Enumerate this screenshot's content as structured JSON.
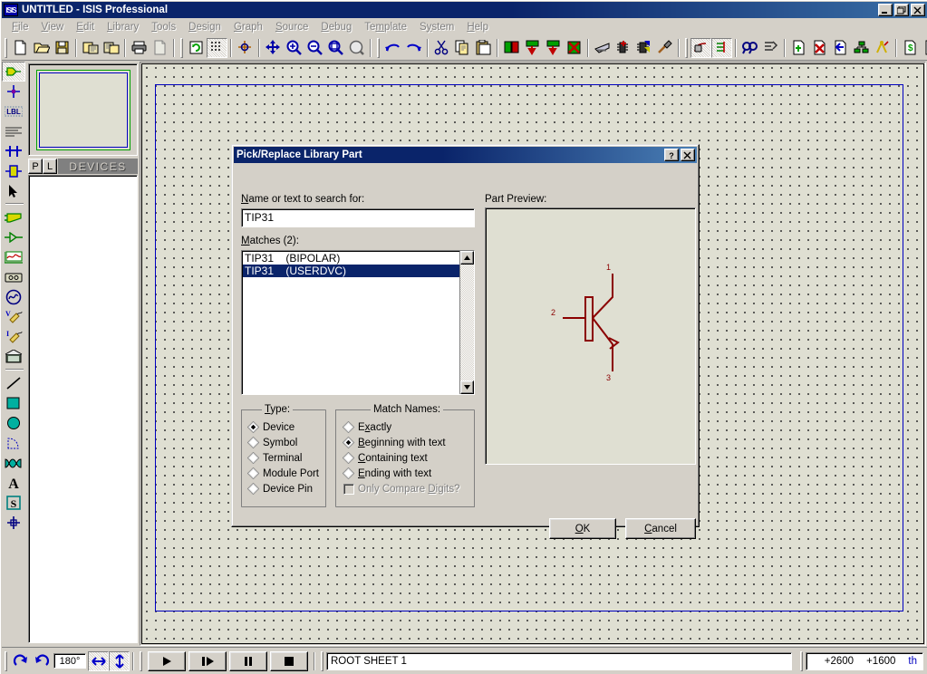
{
  "window": {
    "title": "UNTITLED - ISIS Professional",
    "icon": "isis-logo-icon",
    "minimize": "minimize-button",
    "restore": "restore-button",
    "close": "close-button"
  },
  "menubar": {
    "items": [
      {
        "label": "File",
        "accel": "F"
      },
      {
        "label": "View",
        "accel": "V"
      },
      {
        "label": "Edit",
        "accel": "E"
      },
      {
        "label": "Library",
        "accel": "L"
      },
      {
        "label": "Tools",
        "accel": "T"
      },
      {
        "label": "Design",
        "accel": "D"
      },
      {
        "label": "Graph",
        "accel": "G"
      },
      {
        "label": "Source",
        "accel": "S"
      },
      {
        "label": "Debug",
        "accel": "D"
      },
      {
        "label": "Template",
        "accel": "m"
      },
      {
        "label": "System",
        "accel": "y"
      },
      {
        "label": "Help",
        "accel": "H"
      }
    ]
  },
  "toolbar": {
    "groups": [
      [
        "new-file-icon",
        "open-file-icon",
        "save-file-icon"
      ],
      [
        "import-section-icon",
        "export-section-icon"
      ],
      [
        "print-icon",
        "print-area-icon"
      ],
      [
        "refresh-icon",
        "toggle-grid-icon"
      ],
      [
        "origin-icon"
      ],
      [
        "pan-icon",
        "zoom-in-icon",
        "zoom-out-icon",
        "zoom-area-icon",
        "zoom-all-icon"
      ],
      [
        "undo-icon",
        "redo-icon"
      ],
      [
        "cut-icon",
        "copy-icon",
        "paste-icon"
      ],
      [
        "block-copy-icon",
        "block-move-icon",
        "block-rotate-icon",
        "block-delete-icon"
      ],
      [
        "pick-device-icon",
        "make-device-icon",
        "packaging-tool-icon",
        "decompose-icon"
      ],
      [
        "wire-autorouter-icon",
        "search-tag-icon"
      ],
      [
        "property-assignment-icon",
        "design-explorer-icon"
      ],
      [
        "new-sheet-icon",
        "remove-sheet-icon",
        "exit-sheet-icon",
        "hierarchy-icon",
        "goto-sheet-icon"
      ],
      [
        "bill-of-materials-icon",
        "electrical-rules-icon"
      ],
      [
        "ares-icon"
      ]
    ]
  },
  "left_toolbar": {
    "items": [
      {
        "name": "selection-mode-icon",
        "pressed": true
      },
      {
        "name": "component-mode-icon",
        "pressed": false
      },
      {
        "name": "junction-dot-icon",
        "pressed": false
      },
      {
        "name": "wire-label-icon",
        "pressed": false
      },
      {
        "name": "text-script-icon",
        "pressed": false
      },
      {
        "name": "buses-icon",
        "pressed": false
      },
      {
        "name": "subcircuit-icon",
        "pressed": false
      },
      {
        "name": "instant-edit-icon",
        "pressed": false
      },
      {
        "name": "terminals-mode-icon",
        "pressed": false
      },
      {
        "name": "device-pins-icon",
        "pressed": false
      },
      {
        "name": "graph-mode-icon",
        "pressed": false
      },
      {
        "name": "tape-recorder-icon",
        "pressed": false
      },
      {
        "name": "generator-mode-icon",
        "pressed": false
      },
      {
        "name": "voltage-probe-icon",
        "pressed": false
      },
      {
        "name": "current-probe-icon",
        "pressed": false
      },
      {
        "name": "virtual-instruments-icon",
        "pressed": false
      },
      {
        "name": "line-tool-icon",
        "pressed": false
      },
      {
        "name": "box-tool-icon",
        "pressed": false
      },
      {
        "name": "circle-tool-icon",
        "pressed": false
      },
      {
        "name": "arc-tool-icon",
        "pressed": false
      },
      {
        "name": "path-tool-icon",
        "pressed": false
      },
      {
        "name": "text-tool-icon",
        "pressed": false
      },
      {
        "name": "symbol-tool-icon",
        "pressed": false
      },
      {
        "name": "marker-tool-icon",
        "pressed": false
      }
    ]
  },
  "sidebar": {
    "overview_label": "overview-panel",
    "p_tab": "P",
    "l_tab": "L",
    "devices_header": "DEVICES",
    "devices": []
  },
  "dialog": {
    "title": "Pick/Replace Library Part",
    "help_btn": "?",
    "close_btn": "X",
    "search_label": "Name or text to search for:",
    "search_accel": "N",
    "search_value": "TIP31",
    "matches_label": "Matches (2):",
    "matches_accel": "M",
    "matches": [
      {
        "text": "TIP31    (BIPOLAR)",
        "selected": false
      },
      {
        "text": "TIP31    (USERDVC)",
        "selected": true
      }
    ],
    "preview_label": "Part Preview:",
    "preview_symbol": "npn-transistor-symbol",
    "preview_pins": [
      "1",
      "2",
      "3"
    ],
    "type_group": {
      "legend": "Type:",
      "legend_accel": "T",
      "options": [
        {
          "label": "Device",
          "accel": "D",
          "checked": true
        },
        {
          "label": "Symbol",
          "accel": "S",
          "checked": false
        },
        {
          "label": "Terminal",
          "accel": "",
          "checked": false
        },
        {
          "label": "Module Port",
          "accel": "",
          "checked": false
        },
        {
          "label": "Device Pin",
          "accel": "",
          "checked": false
        }
      ]
    },
    "match_group": {
      "legend": "Match Names:",
      "options": [
        {
          "label": "Exactly",
          "accel": "x",
          "checked": false
        },
        {
          "label": "Beginning with text",
          "accel": "B",
          "checked": true
        },
        {
          "label": "Containing text",
          "accel": "C",
          "checked": false
        },
        {
          "label": "Ending with text",
          "accel": "E",
          "checked": false
        }
      ],
      "checkbox": {
        "label": "Only Compare Digits?",
        "accel": "D",
        "checked": false,
        "disabled": true
      }
    },
    "ok_label": "OK",
    "ok_accel": "O",
    "cancel_label": "Cancel",
    "cancel_accel": "C"
  },
  "statusbar": {
    "rotate_cw": "rotate-clockwise-icon",
    "rotate_ccw": "rotate-counterclockwise-icon",
    "rotation_value": "180°",
    "mirror_x": "mirror-horizontal-icon",
    "mirror_y": "mirror-vertical-icon",
    "play": "play-button",
    "step": "step-button",
    "pause": "pause-button",
    "stop": "stop-button",
    "sheet_name": "ROOT SHEET 1",
    "coord_x": "+2600",
    "coord_y": "+1600",
    "coord_units": "th"
  },
  "colors": {
    "face": "#d4d0c8",
    "title_active": "#0a246a",
    "canvas": "#dfdfd2",
    "sheet_border": "#0000c0",
    "selection": "#0a246a",
    "symbol_red": "#8b0000",
    "units_blue": "#0000c0"
  }
}
